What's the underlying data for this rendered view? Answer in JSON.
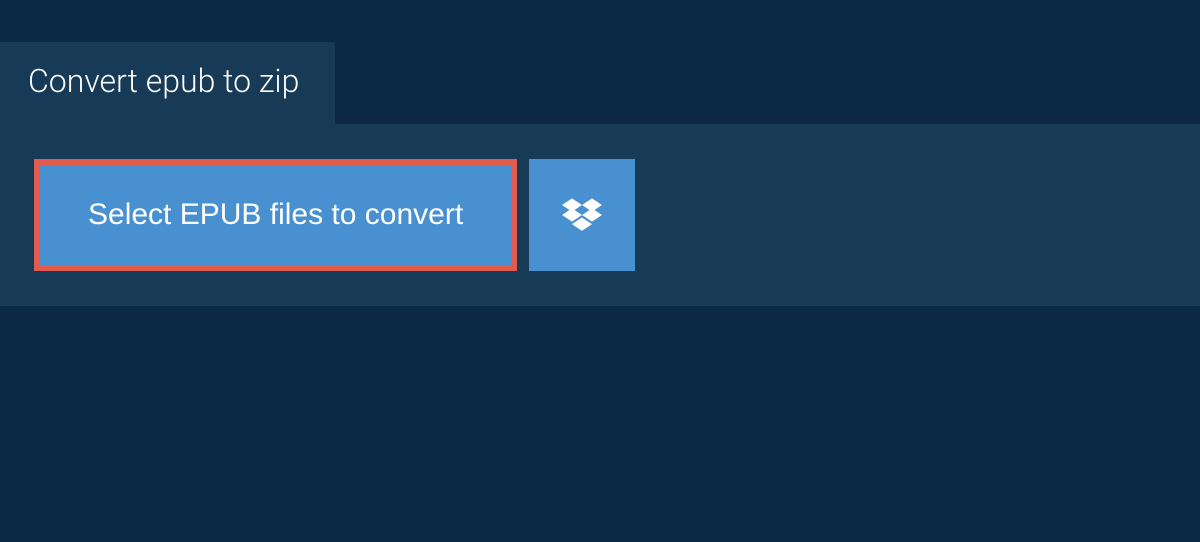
{
  "tab": {
    "title": "Convert epub to zip"
  },
  "upload": {
    "select_label": "Select EPUB files to convert"
  },
  "colors": {
    "background": "#0c2a47",
    "panel": "#173a56",
    "button": "#4990d1",
    "highlight_border": "#e35a4f"
  }
}
